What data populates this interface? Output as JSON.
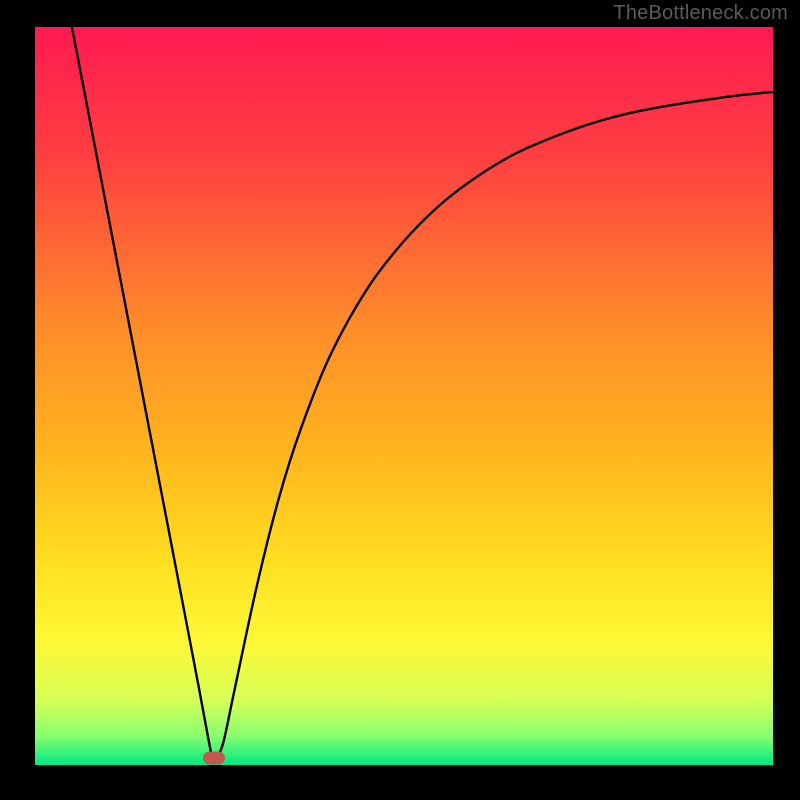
{
  "watermark": "TheBottleneck.com",
  "chart_data": {
    "type": "line",
    "title": "",
    "xlabel": "",
    "ylabel": "",
    "xlim": [
      0,
      100
    ],
    "ylim": [
      0,
      100
    ],
    "grid": false,
    "legend": false,
    "gradient_stops": [
      {
        "offset": 0,
        "color": "#ff1a52"
      },
      {
        "offset": 0.18,
        "color": "#ff4040"
      },
      {
        "offset": 0.4,
        "color": "#ff8a2a"
      },
      {
        "offset": 0.58,
        "color": "#ffb61e"
      },
      {
        "offset": 0.72,
        "color": "#ffdd20"
      },
      {
        "offset": 0.83,
        "color": "#fff835"
      },
      {
        "offset": 0.91,
        "color": "#d8ff55"
      },
      {
        "offset": 0.96,
        "color": "#8aff70"
      },
      {
        "offset": 1.0,
        "color": "#00e884"
      }
    ],
    "series": [
      {
        "name": "bottleneck-curve",
        "color": "#000000",
        "x": [
          5.0,
          7.5,
          10.0,
          12.5,
          15.0,
          17.5,
          20.0,
          22.2,
          23.5,
          24.0,
          24.5,
          25.5,
          27.0,
          30.0,
          33.0,
          36.0,
          40.0,
          45.0,
          50.0,
          55.0,
          60.0,
          65.0,
          70.0,
          75.0,
          80.0,
          85.0,
          90.0,
          95.0,
          100.0
        ],
        "y": [
          100.0,
          87.0,
          74.0,
          61.0,
          48.0,
          35.0,
          22.0,
          10.5,
          3.5,
          1.2,
          1.0,
          3.0,
          10.0,
          24.0,
          36.0,
          45.5,
          55.5,
          64.5,
          71.0,
          76.0,
          79.8,
          82.8,
          85.0,
          86.8,
          88.2,
          89.2,
          90.0,
          90.7,
          91.2
        ]
      }
    ],
    "marker": {
      "name": "optimal-point",
      "x": 24.2,
      "y": 1.0,
      "color": "#c1594d"
    }
  }
}
